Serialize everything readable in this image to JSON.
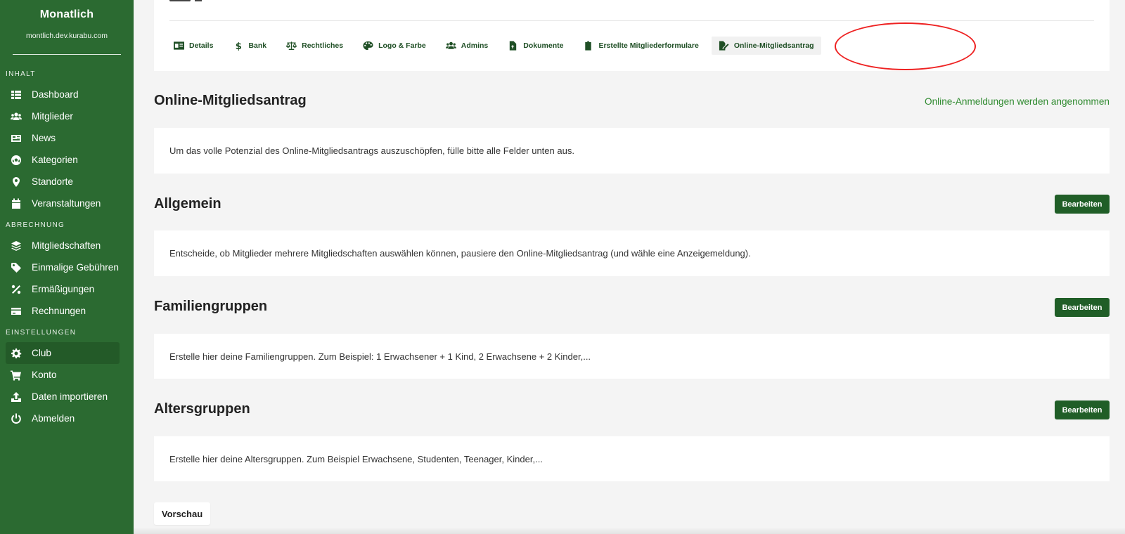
{
  "sidebar": {
    "club_name": "Monatlich",
    "club_domain": "montlich.dev.kurabu.com",
    "sections": {
      "content": "INHALT",
      "billing": "ABRECHNUNG",
      "settings": "EINSTELLUNGEN"
    },
    "content_items": [
      {
        "label": "Dashboard",
        "icon": "table-icon"
      },
      {
        "label": "Mitglieder",
        "icon": "users-icon"
      },
      {
        "label": "News",
        "icon": "newspaper-icon"
      },
      {
        "label": "Kategorien",
        "icon": "soccer-ball-icon"
      },
      {
        "label": "Standorte",
        "icon": "map-pin-icon"
      },
      {
        "label": "Veranstaltungen",
        "icon": "calendar-icon"
      }
    ],
    "billing_items": [
      {
        "label": "Mitgliedschaften",
        "icon": "layers-icon"
      },
      {
        "label": "Einmalige Gebühren",
        "icon": "tag-icon"
      },
      {
        "label": "Ermäßigungen",
        "icon": "percent-icon"
      },
      {
        "label": "Rechnungen",
        "icon": "credit-card-icon"
      }
    ],
    "settings_items": [
      {
        "label": "Club",
        "icon": "gear-icon",
        "active": true
      },
      {
        "label": "Konto",
        "icon": "cart-icon"
      },
      {
        "label": "Daten importieren",
        "icon": "upload-icon"
      },
      {
        "label": "Abmelden",
        "icon": "power-icon"
      }
    ]
  },
  "tabs": [
    {
      "label": "Details",
      "icon": "id-card-icon"
    },
    {
      "label": "Bank",
      "icon": "dollar-icon"
    },
    {
      "label": "Rechtliches",
      "icon": "scale-icon"
    },
    {
      "label": "Logo & Farbe",
      "icon": "palette-icon"
    },
    {
      "label": "Admins",
      "icon": "users-icon"
    },
    {
      "label": "Dokumente",
      "icon": "file-upload-icon"
    },
    {
      "label": "Erstellte Mitgliederformulare",
      "icon": "clipboard-icon"
    },
    {
      "label": "Online-Mitgliedsantrag",
      "icon": "file-signature-icon",
      "active": true
    }
  ],
  "main": {
    "title": "Online-Mitgliedsantrag",
    "status": "Online-Anmeldungen werden angenommen",
    "intro": "Um das volle Potenzial des Online-Mitgliedsantrags auszuschöpfen, fülle bitte alle Felder unten aus.",
    "sections": [
      {
        "title": "Allgemein",
        "button": "Bearbeiten",
        "text": "Entscheide, ob Mitglieder mehrere Mitgliedschaften auswählen können, pausiere den Online-Mitgliedsantrag (und wähle eine Anzeigemeldung)."
      },
      {
        "title": "Familiengruppen",
        "button": "Bearbeiten",
        "text": "Erstelle hier deine Familiengruppen. Zum Beispiel: 1 Erwachsener + 1 Kind, 2 Erwachsene + 2 Kinder,..."
      },
      {
        "title": "Altersgruppen",
        "button": "Bearbeiten",
        "text": "Erstelle hier deine Altersgruppen. Zum Beispiel Erwachsene, Studenten, Teenager, Kinder,..."
      }
    ],
    "preview_button": "Vorschau"
  },
  "colors": {
    "sidebar_bg": "#2b6a31",
    "accent": "#205e27",
    "status": "#2f8a2f",
    "highlight_circle": "#e22222"
  }
}
